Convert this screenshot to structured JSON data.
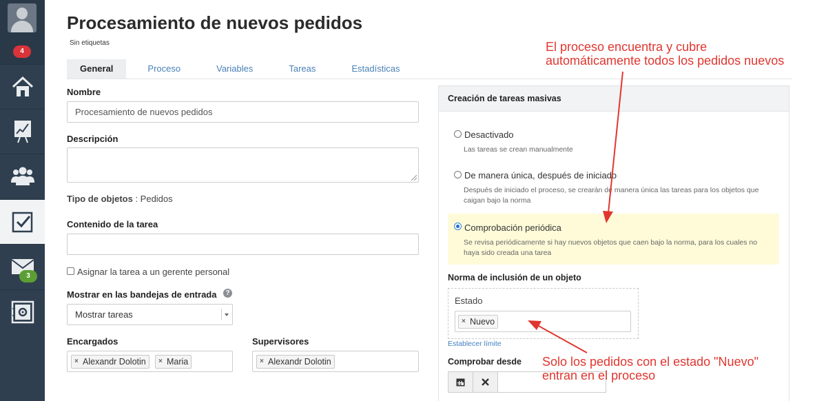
{
  "sidebar": {
    "notifications_badge": "4",
    "messages_badge": "3",
    "items": [
      {
        "name": "home-icon"
      },
      {
        "name": "reports-chart-icon"
      },
      {
        "name": "users-group-icon"
      },
      {
        "name": "tasks-checkbox-icon",
        "active": true
      },
      {
        "name": "mail-icon"
      },
      {
        "name": "settings-icon"
      }
    ]
  },
  "page": {
    "title": "Procesamiento de nuevos pedidos",
    "tags": "Sin etiquetas"
  },
  "tabs": [
    "General",
    "Proceso",
    "Variables",
    "Tareas",
    "Estadísticas"
  ],
  "form": {
    "name_label": "Nombre",
    "name_value": "Procesamiento de nuevos pedidos",
    "description_label": "Descripción",
    "description_value": "",
    "object_type_label": "Tipo de objetos",
    "object_type_value": " : Pedidos",
    "task_content_label": "Contenido de la tarea",
    "task_content_value": "",
    "assign_manager_label": "Asignar la tarea a un gerente personal",
    "inbox_label": "Mostrar en las bandejas de entrada",
    "help_symbol": "?",
    "inbox_value": "Mostrar tareas",
    "assignees_label": "Encargados",
    "assignees": [
      "Alexandr Dolotin",
      "Maria"
    ],
    "supervisors_label": "Supervisores",
    "supervisors": [
      "Alexandr Dolotin"
    ],
    "chip_remove": "×"
  },
  "mass_tasks": {
    "title": "Creación de tareas masivas",
    "options": [
      {
        "label": "Desactivado",
        "desc": "Las tareas se crean manualmente",
        "selected": false
      },
      {
        "label": "De manera única, después de iniciado",
        "desc": "Después de iniciado el proceso, se crearán de manera única las tareas para los objetos que caigan bajo la norma",
        "selected": false
      },
      {
        "label": "Comprobación periódica",
        "desc": "Se revisa periódicamente si hay nuevos objetos que caen bajo la norma, para los cuales no haya sido creada una tarea",
        "selected": true
      }
    ],
    "inclusion_label": "Norma de inclusión de un objeto",
    "status_label": "Estado",
    "status_tags": [
      "Nuevo"
    ],
    "set_limit_link": "Establecer límite",
    "check_from_label": "Comprobar desde"
  },
  "annotations": {
    "top_line1": "El proceso encuentra y cubre",
    "top_line2": "automáticamente todos los pedidos nuevos",
    "bottom_line1": "Solo los pedidos con el estado \"Nuevo\"",
    "bottom_line2": "entran en el proceso"
  },
  "colors": {
    "sidebar_bg": "#2f3f4f",
    "link": "#4a80b5",
    "highlight": "#fffbd9",
    "annotation": "#e0362f",
    "badge_red": "#d9343a",
    "badge_green": "#5c9e33"
  }
}
